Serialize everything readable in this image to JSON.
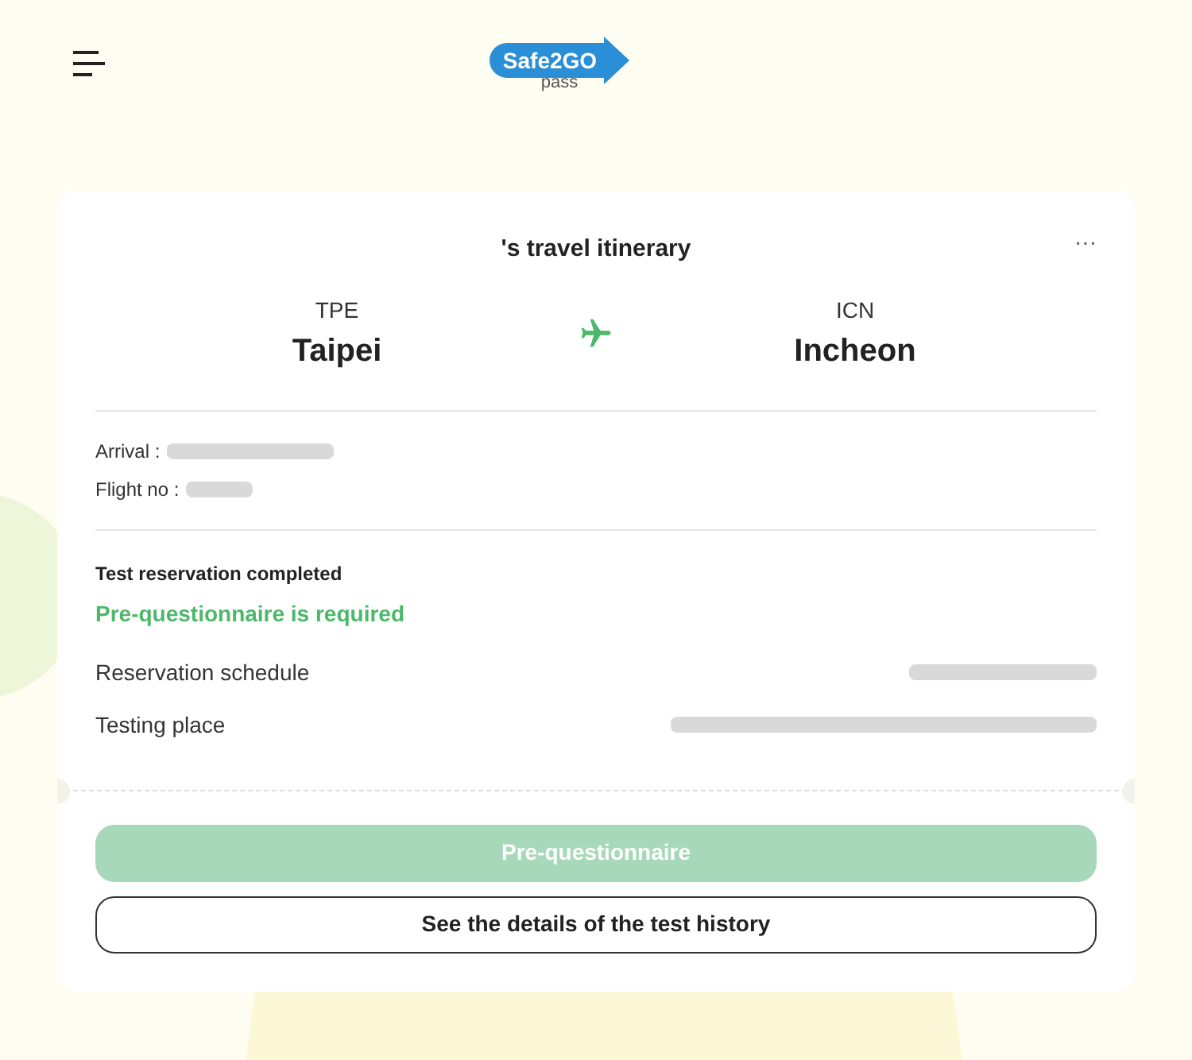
{
  "header": {
    "logo": {
      "brand": "Safe2GO",
      "sub": "pass"
    }
  },
  "itinerary": {
    "title": "'s travel itinerary",
    "more": "···",
    "origin": {
      "code": "TPE",
      "city": "Taipei"
    },
    "destination": {
      "code": "ICN",
      "city": "Incheon"
    },
    "details": [
      {
        "label": "Arrival :",
        "redacted": true
      },
      {
        "label": "Flight no :",
        "redacted": true
      }
    ],
    "status": "Test reservation completed",
    "notice": "Pre-questionnaire is required",
    "rows": [
      {
        "label": "Reservation schedule",
        "redacted": true
      },
      {
        "label": "Testing place",
        "redacted": true
      }
    ],
    "buttons": [
      {
        "label": "Pre-questionnaire",
        "kind": "primary",
        "disabled": true
      },
      {
        "label": "See the details of the test history",
        "kind": "outline",
        "disabled": false
      }
    ]
  }
}
